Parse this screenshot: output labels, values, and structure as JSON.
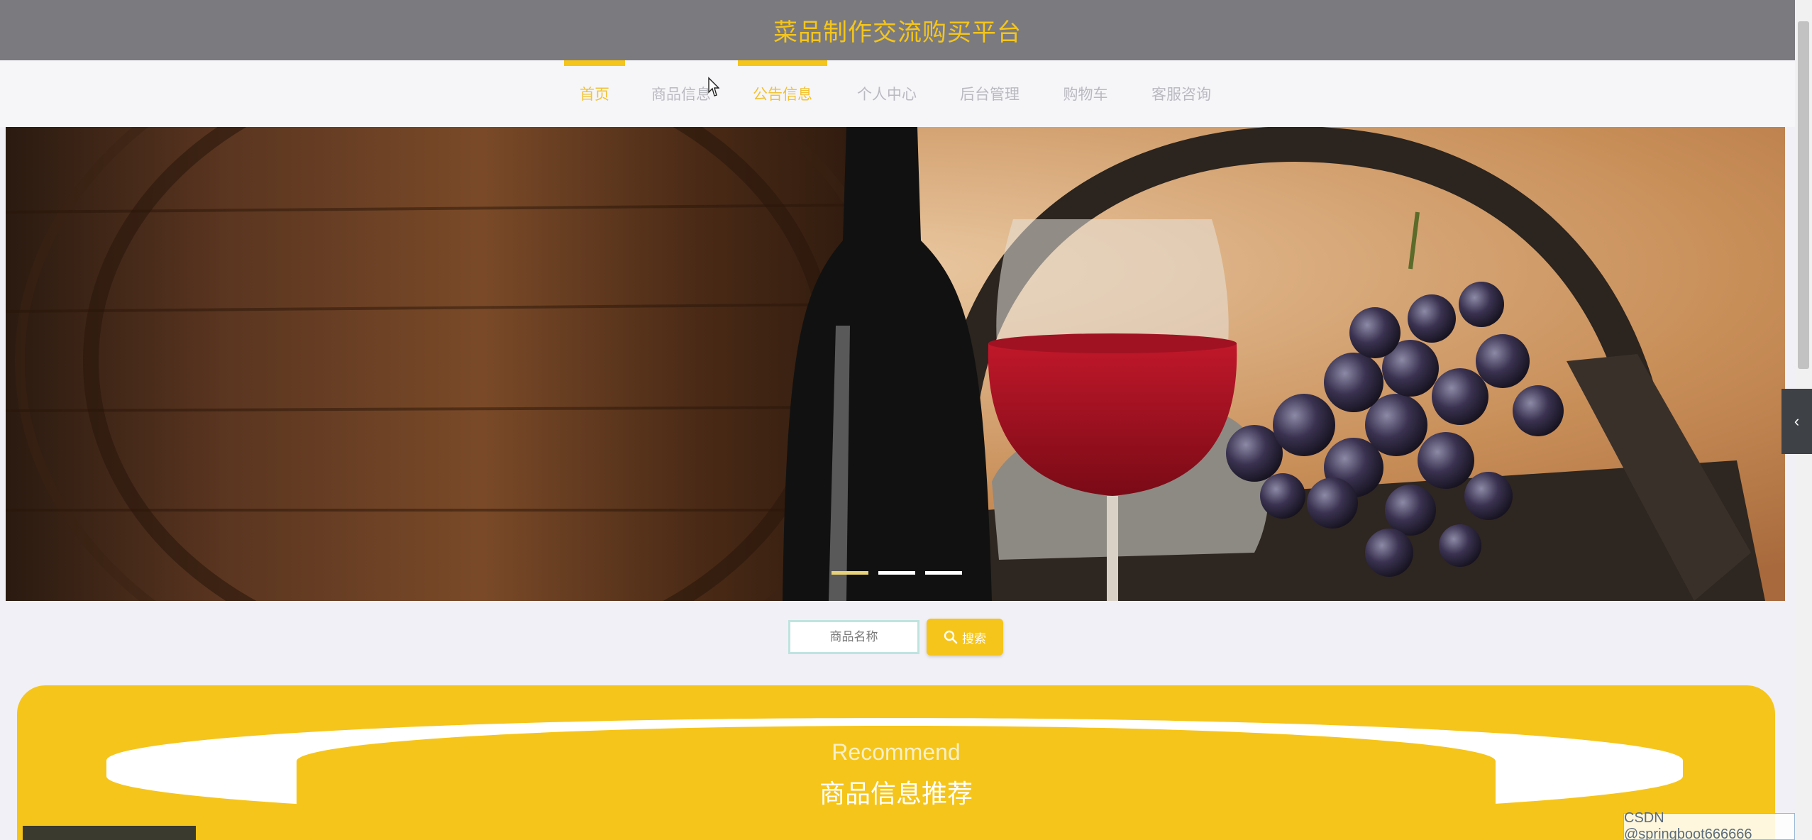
{
  "header": {
    "title": "菜品制作交流购买平台"
  },
  "nav": {
    "items": [
      {
        "label": "首页",
        "active": true
      },
      {
        "label": "商品信息",
        "active": false
      },
      {
        "label": "公告信息",
        "active": true
      },
      {
        "label": "个人中心",
        "active": false
      },
      {
        "label": "后台管理",
        "active": false
      },
      {
        "label": "购物车",
        "active": false
      },
      {
        "label": "客服咨询",
        "active": false
      }
    ]
  },
  "banner": {
    "slides": 3,
    "active_slide": 1
  },
  "search": {
    "placeholder": "商品名称",
    "button_label": "搜索"
  },
  "recommend": {
    "title_en": "Recommend",
    "title_cn": "商品信息推荐"
  },
  "watermark": {
    "text": "CSDN @springboot666666"
  },
  "colors": {
    "accent": "#f5c51b",
    "header_bg": "#7b7b7f",
    "page_bg": "#f1f0f6"
  }
}
